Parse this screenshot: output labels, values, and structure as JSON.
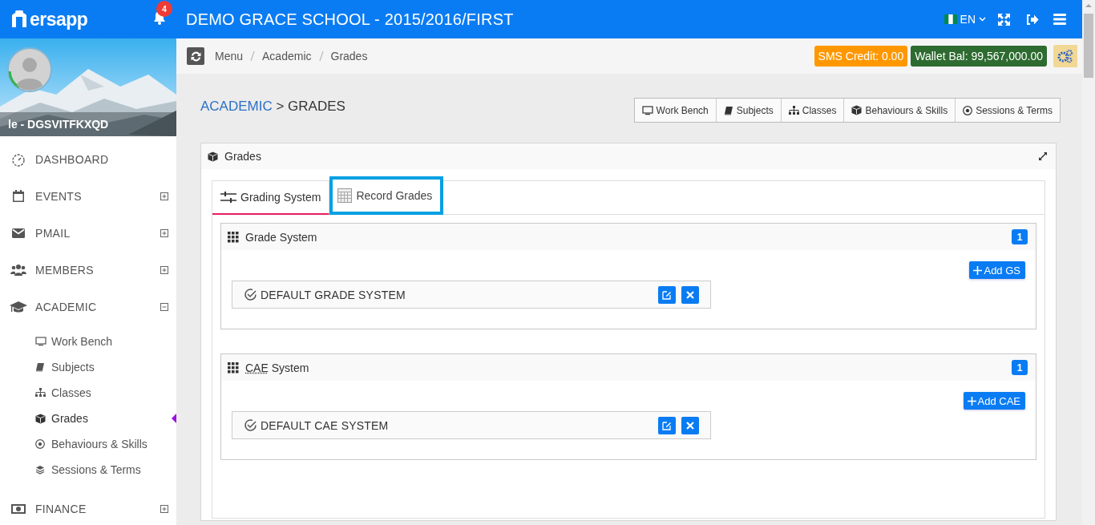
{
  "topbar": {
    "logo": "ersapp",
    "notifications": "4",
    "title": "DEMO GRACE SCHOOL - 2015/2016/FIRST",
    "language": "EN"
  },
  "profile": {
    "name": "le - DGSVITFKXQD"
  },
  "sidebar": {
    "items": [
      {
        "label": "DASHBOARD",
        "kind": "link"
      },
      {
        "label": "EVENTS",
        "kind": "group",
        "expanded": false
      },
      {
        "label": "PMAIL",
        "kind": "group",
        "expanded": false
      },
      {
        "label": "MEMBERS",
        "kind": "group",
        "expanded": false
      },
      {
        "label": "ACADEMIC",
        "kind": "group",
        "expanded": true,
        "children": [
          {
            "label": "Work Bench",
            "selected": false
          },
          {
            "label": "Subjects",
            "selected": false
          },
          {
            "label": "Classes",
            "selected": false
          },
          {
            "label": "Grades",
            "selected": true
          },
          {
            "label": "Behaviours & Skills",
            "selected": false
          },
          {
            "label": "Sessions & Terms",
            "selected": false
          }
        ]
      },
      {
        "label": "FINANCE",
        "kind": "group",
        "expanded": false
      }
    ]
  },
  "breadcrumb": [
    "Menu",
    "Academic",
    "Grades"
  ],
  "balances": [
    {
      "label": "SMS Credit: 0.00",
      "color": "#ff9800"
    },
    {
      "label": "Wallet Bal: 99,567,000.00",
      "color": "#2e6b30"
    }
  ],
  "heading": {
    "section": "ACADEMIC",
    "page": "> GRADES"
  },
  "shortcuts": [
    "Work Bench",
    "Subjects",
    "Classes",
    "Behaviours & Skills",
    "Sessions & Terms"
  ],
  "panel": {
    "title": "Grades",
    "tabs": [
      {
        "label": "Grading System",
        "selected": true,
        "focused": false
      },
      {
        "label": "Record Grades",
        "selected": false,
        "focused": true
      }
    ],
    "sections": [
      {
        "title": "Grade System",
        "count": "1",
        "add_button": "Add GS",
        "entries": [
          "DEFAULT GRADE SYSTEM"
        ]
      },
      {
        "title_abbr": "CAE",
        "title": "System",
        "count": "1",
        "add_button": "Add CAE",
        "entries": [
          "DEFAULT CAE SYSTEM"
        ]
      }
    ]
  }
}
